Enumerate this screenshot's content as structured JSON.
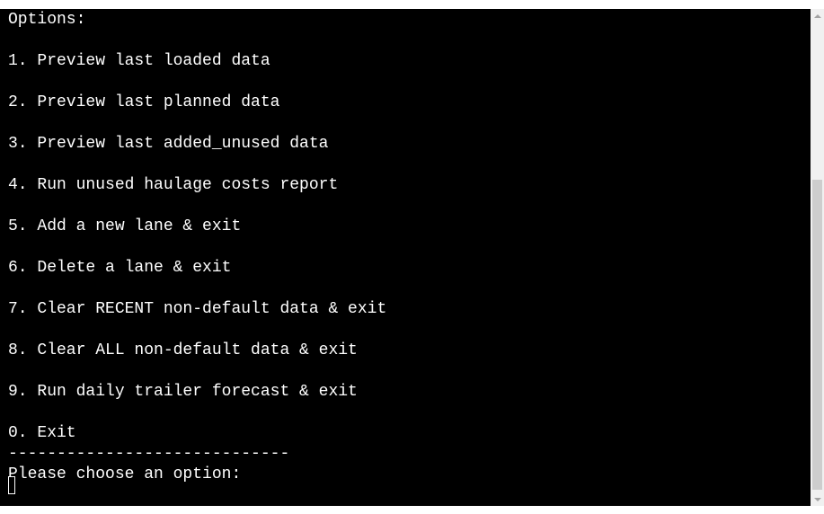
{
  "terminal": {
    "header": "Options:",
    "options": [
      "1. Preview last loaded data",
      "2. Preview last planned data",
      "3. Preview last added_unused data",
      "4. Run unused haulage costs report",
      "5. Add a new lane & exit",
      "6. Delete a lane & exit",
      "7. Clear RECENT non-default data & exit",
      "8. Clear ALL non-default data & exit",
      "9. Run daily trailer forecast & exit",
      "0. Exit"
    ],
    "separator": "-----------------------------",
    "prompt": "Please choose an option:"
  },
  "scrollbar": {
    "up_icon": "chevron-up-icon",
    "down_icon": "chevron-down-icon"
  },
  "colors": {
    "terminal_background": "#000000",
    "terminal_text": "#ffffff",
    "scrollbar_track": "#f0f0f0",
    "scrollbar_thumb": "#cdcdcd"
  }
}
